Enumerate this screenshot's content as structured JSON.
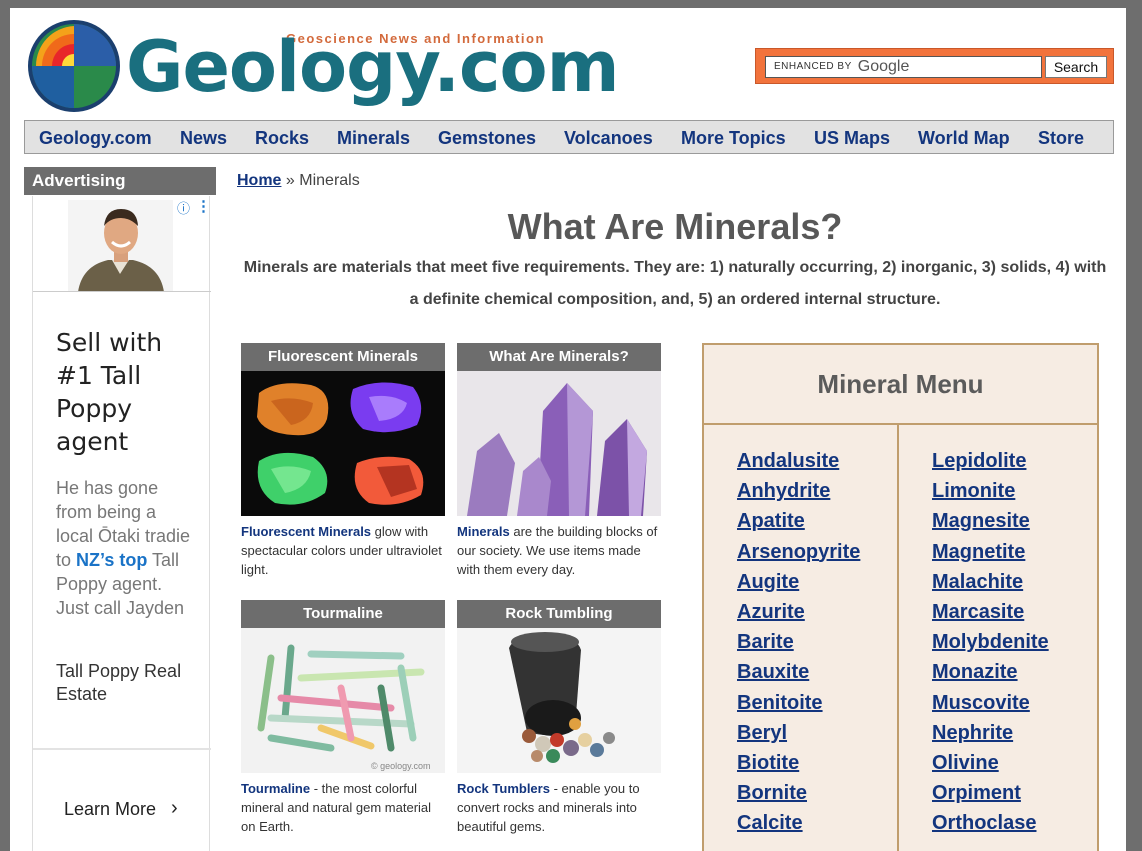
{
  "header": {
    "tagline": "Geoscience News and Information",
    "logo_text": "Geology.com",
    "search_enhanced": "ENHANCED BY",
    "search_google": "Google",
    "search_button": "Search"
  },
  "nav": {
    "items": [
      "Geology.com",
      "News",
      "Rocks",
      "Minerals",
      "Gemstones",
      "Volcanoes",
      "More Topics",
      "US Maps",
      "World Map",
      "Store"
    ]
  },
  "sidebar": {
    "heading": "Advertising",
    "ad": {
      "info_icon": "info-icon",
      "headline": "Sell with #1 Tall Poppy agent",
      "body_before": "He has gone from being a local Ōtaki tradie to",
      "body_highlight": "NZ’s top",
      "body_after": "Tall Poppy agent. Just call Jayden",
      "brand": "Tall Poppy Real Estate",
      "cta": "Learn More"
    }
  },
  "breadcrumb": {
    "home": "Home",
    "separator": "»",
    "current": "Minerals"
  },
  "main": {
    "title": "What Are Minerals?",
    "intro": "Minerals are materials that meet five requirements. They are: 1) naturally occurring, 2) inorganic, 3) solids, 4) with a definite chemical composition, and, 5) an ordered internal structure.",
    "cards": [
      {
        "heading": "Fluorescent Minerals",
        "lead": "Fluorescent Minerals",
        "text": " glow with spectacular colors under ultraviolet light."
      },
      {
        "heading": "What Are Minerals?",
        "lead": "Minerals",
        "text": " are the building blocks of our society. We use items made with them every day."
      },
      {
        "heading": "Tourmaline",
        "lead": "Tourmaline",
        "text": " - the most colorful mineral and natural gem material on Earth."
      },
      {
        "heading": "Rock Tumbling",
        "lead": "Rock Tumblers",
        "text": " - enable you to convert rocks and minerals into beautiful gems."
      }
    ],
    "watermark": "© geology.com"
  },
  "mineral_menu": {
    "title": "Mineral Menu",
    "left": [
      "Andalusite",
      "Anhydrite",
      "Apatite",
      "Arsenopyrite",
      "Augite",
      "Azurite",
      "Barite",
      "Bauxite",
      "Benitoite",
      "Beryl",
      "Biotite",
      "Bornite",
      "Calcite"
    ],
    "right": [
      "Lepidolite",
      "Limonite",
      "Magnesite",
      "Magnetite",
      "Malachite",
      "Marcasite",
      "Molybdenite",
      "Monazite",
      "Muscovite",
      "Nephrite",
      "Olivine",
      "Orpiment",
      "Orthoclase"
    ]
  },
  "colors": {
    "link": "#13357e",
    "logo": "#1a6f7f",
    "search_border": "#f2733c",
    "menu_bg": "#f6ece3",
    "menu_border": "#c09d6d"
  }
}
